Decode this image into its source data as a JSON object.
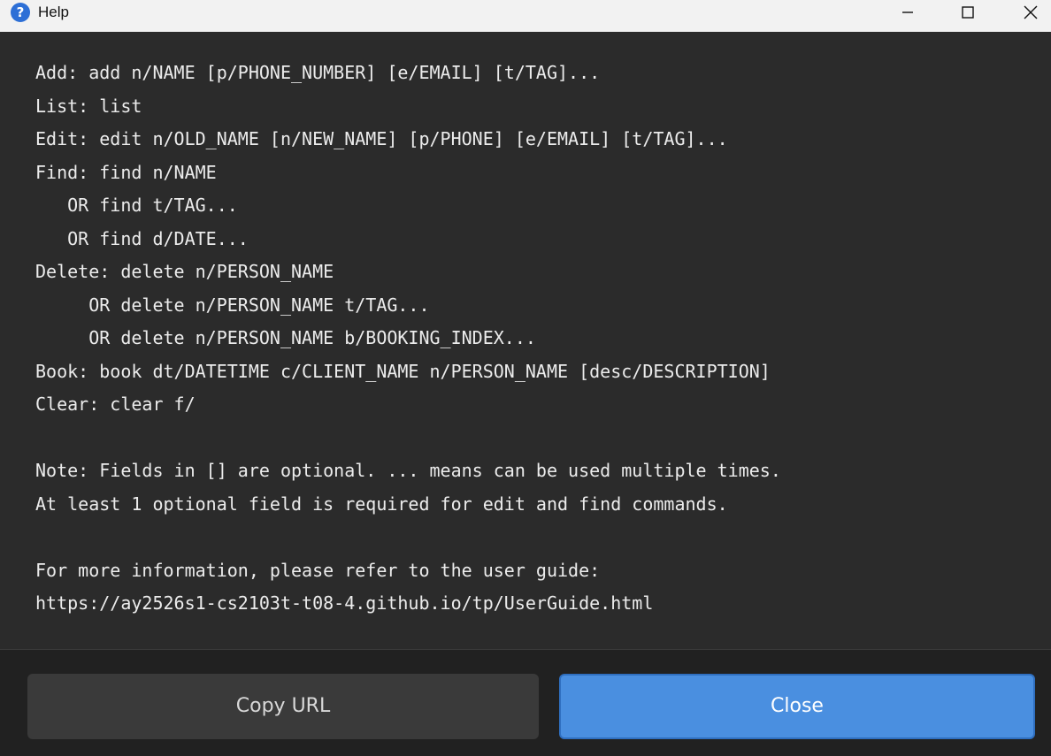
{
  "window": {
    "title": "Help",
    "icon": "help-question-icon",
    "controls": [
      "minimize-icon",
      "maximize-icon",
      "close-icon"
    ]
  },
  "help": {
    "lines": [
      "Add: add n/NAME [p/PHONE_NUMBER] [e/EMAIL] [t/TAG]...",
      "List: list",
      "Edit: edit n/OLD_NAME [n/NEW_NAME] [p/PHONE] [e/EMAIL] [t/TAG]...",
      "Find: find n/NAME",
      "   OR find t/TAG...",
      "   OR find d/DATE...",
      "Delete: delete n/PERSON_NAME",
      "     OR delete n/PERSON_NAME t/TAG...",
      "     OR delete n/PERSON_NAME b/BOOKING_INDEX...",
      "Book: book dt/DATETIME c/CLIENT_NAME n/PERSON_NAME [desc/DESCRIPTION]",
      "Clear: clear f/",
      "",
      "Note: Fields in [] are optional. ... means can be used multiple times.",
      "At least 1 optional field is required for edit and find commands.",
      "",
      "For more information, please refer to the user guide:",
      "https://ay2526s1-cs2103t-t08-4.github.io/tp/UserGuide.html"
    ]
  },
  "buttons": {
    "copy_url": "Copy URL",
    "close": "Close"
  },
  "colors": {
    "background": "#2b2b2b",
    "footer": "#212121",
    "primary_button": "#4a8fe0",
    "secondary_button": "#3a3a3a",
    "text": "#ececec"
  }
}
